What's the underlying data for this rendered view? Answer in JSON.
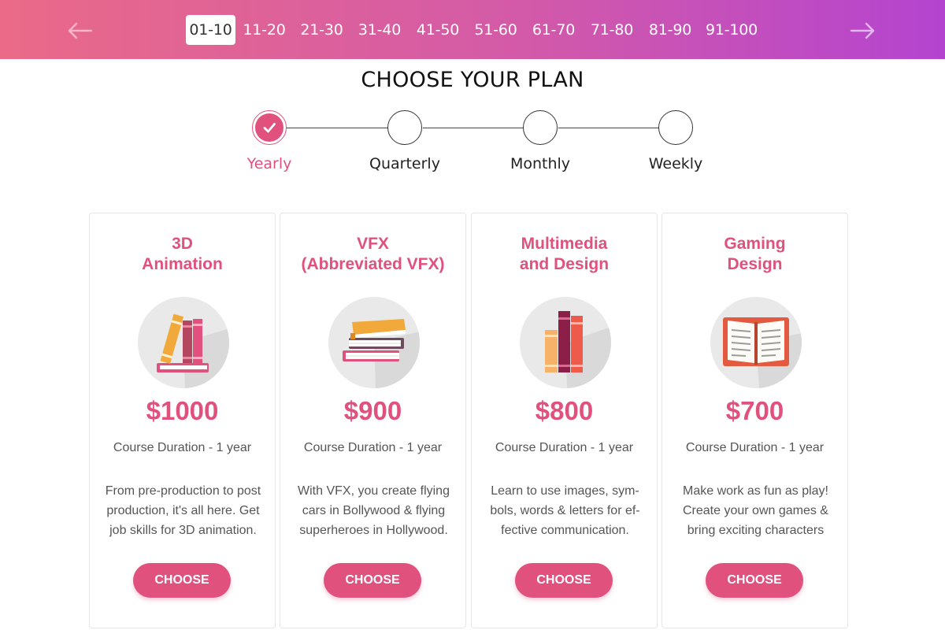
{
  "nav": {
    "prev_icon": "arrow-left-icon",
    "next_icon": "arrow-right-icon",
    "pages": [
      "01-10",
      "11-20",
      "21-30",
      "31-40",
      "41-50",
      "51-60",
      "61-70",
      "71-80",
      "81-90",
      "91-100"
    ],
    "active_page": "01-10",
    "gradient": [
      "#ea6a88",
      "#b444d0"
    ]
  },
  "title": "CHOOSE YOUR PLAN",
  "plans": {
    "steps": [
      "Yearly",
      "Quarterly",
      "Monthly",
      "Weekly"
    ],
    "active_step": "Yearly",
    "accent": "#e0517e"
  },
  "cards": [
    {
      "title_lines": [
        "3D",
        "Animation"
      ],
      "icon": "books-stack-icon",
      "price": "$1000",
      "duration": "Course Duration - 1 year",
      "desc_lines": [
        "From pre-production to post",
        "production, it's all here. Get",
        "job skills for 3D animation."
      ],
      "button": "CHOOSE"
    },
    {
      "title_lines": [
        "VFX",
        "(Abbreviated VFX)"
      ],
      "icon": "books-pile-icon",
      "price": "$900",
      "duration": "Course Duration - 1 year",
      "desc_lines": [
        "With VFX, you create flying",
        "cars in Bollywood & flying",
        "superheroes in Hollywood."
      ],
      "button": "CHOOSE"
    },
    {
      "title_lines": [
        "Multimedia",
        "and Design"
      ],
      "icon": "books-upright-icon",
      "price": "$800",
      "duration": "Course Duration - 1 year",
      "desc_lines": [
        "Learn to use images, sym-",
        "bols, words & letters for ef-",
        "fective communication."
      ],
      "button": "CHOOSE"
    },
    {
      "title_lines": [
        "Gaming",
        "Design"
      ],
      "icon": "open-book-icon",
      "price": "$700",
      "duration": "Course Duration - 1 year",
      "desc_lines": [
        "Make work as fun as play!",
        "Create your own games &",
        "bring exciting characters"
      ],
      "button": "CHOOSE"
    }
  ]
}
